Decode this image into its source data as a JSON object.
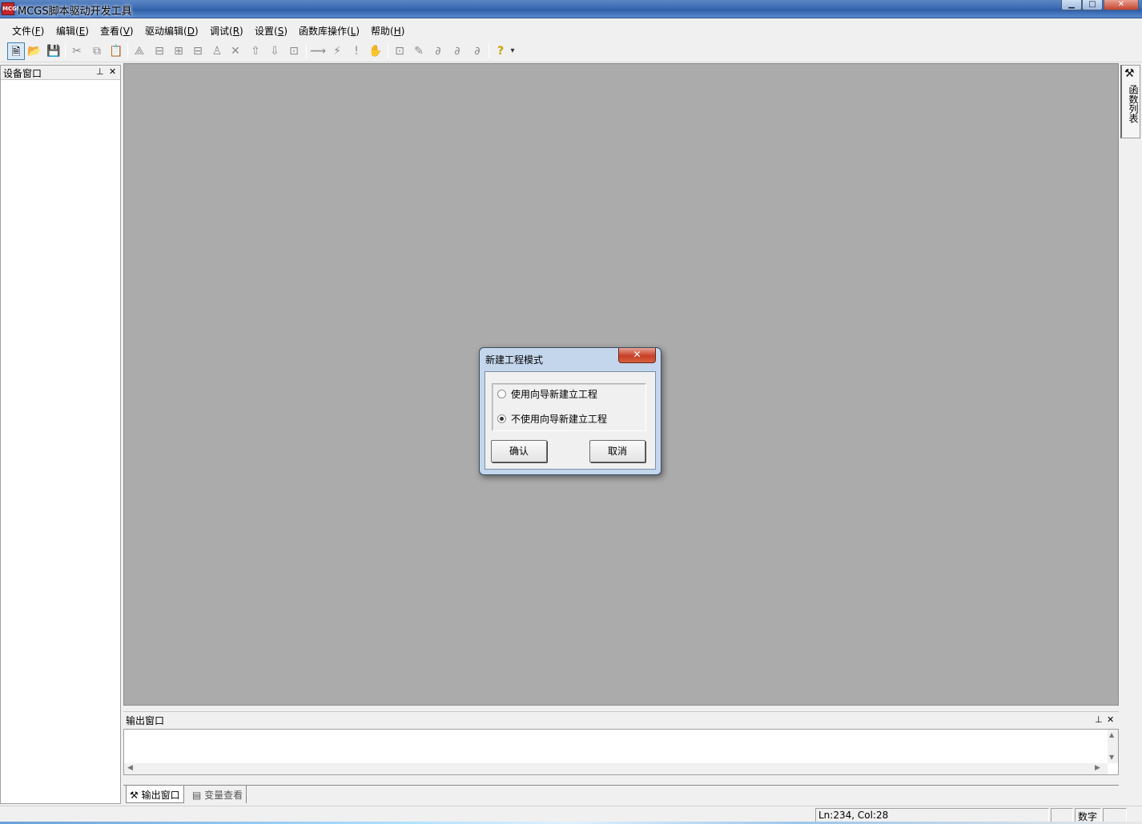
{
  "window": {
    "title": "MCGS脚本驱动开发工具",
    "app_icon_text": "MCGS"
  },
  "window_controls": {
    "minimize": "▁",
    "maximize": "□",
    "close": "✕"
  },
  "menu": [
    {
      "text": "文件(",
      "key": "F",
      "end": ")"
    },
    {
      "text": "编辑(",
      "key": "E",
      "end": ")"
    },
    {
      "text": "查看(",
      "key": "V",
      "end": ")"
    },
    {
      "text": "驱动编辑(",
      "key": "D",
      "end": ")"
    },
    {
      "text": "调试(",
      "key": "R",
      "end": ")"
    },
    {
      "text": "设置(",
      "key": "S",
      "end": ")"
    },
    {
      "text": "函数库操作(",
      "key": "L",
      "end": ")"
    },
    {
      "text": "帮助(",
      "key": "H",
      "end": ")"
    }
  ],
  "toolbar": {
    "new": "🗎",
    "open": "📂",
    "save": "💾",
    "cut": "✂",
    "copy": "⧉",
    "paste": "📋",
    "t1": "⟁",
    "t2": "⊟",
    "t3": "⊞",
    "t4": "⊟",
    "t5": "♙",
    "delete": "✕",
    "up": "⇧",
    "down": "⇩",
    "t6": "⊡",
    "t7": "⟿",
    "t8": "⚡",
    "t9": "!",
    "hand": "✋",
    "t10": "⊡",
    "t11": "✎",
    "t12": "∂",
    "t13": "∂",
    "t14": "∂",
    "help": "?",
    "dropdown": "▾"
  },
  "left_panel": {
    "title": "设备窗口",
    "pin": "⊥",
    "close": "✕"
  },
  "right_tab": {
    "icon": "⚒",
    "label": "函数列表"
  },
  "output_panel": {
    "title": "输出窗口",
    "pin": "⊥",
    "close": "✕",
    "scroll_up": "▲",
    "scroll_down": "▼",
    "scroll_left": "◀",
    "scroll_right": "▶",
    "tabs": [
      {
        "icon": "⚒",
        "label": "输出窗口"
      },
      {
        "icon": "▤",
        "label": "变量查看"
      }
    ]
  },
  "status_bar": {
    "position": "Ln:234, Col:28",
    "mode": "数字"
  },
  "dialog": {
    "title": "新建工程模式",
    "close": "✕",
    "options": [
      {
        "label": "使用向导新建立工程",
        "checked": false
      },
      {
        "label": "不使用向导新建立工程",
        "checked": true
      }
    ],
    "ok_label": "确认",
    "cancel_label": "取消"
  }
}
